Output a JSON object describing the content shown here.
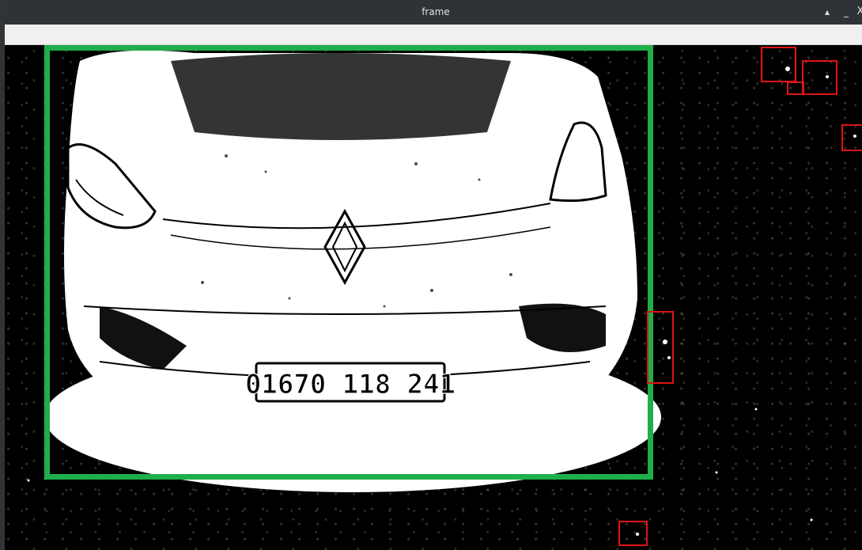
{
  "window": {
    "title": "frame",
    "controls": {
      "maximize_icon": "caret-up-icon",
      "minimize_icon": "minimize-icon",
      "close_icon": "close-icon",
      "maximize_glyph": "▴",
      "minimize_glyph": "_",
      "close_glyph": "X"
    }
  },
  "image": {
    "plate_text": "01670 118 241",
    "detection_color": "#1fae4b",
    "region_color": "#e01414",
    "red_box_count": 6
  }
}
